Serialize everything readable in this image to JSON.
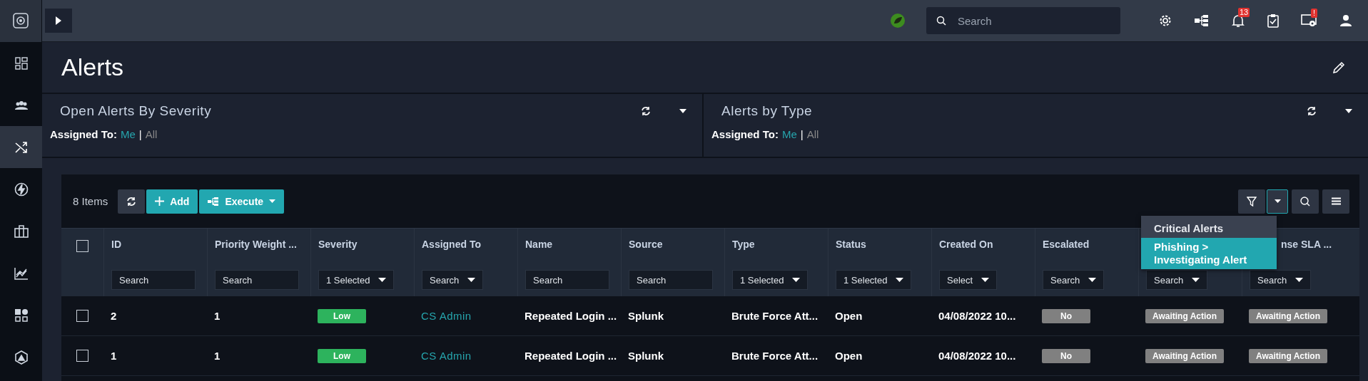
{
  "topbar": {
    "search": {
      "placeholder": "Search"
    },
    "notification_count": "13",
    "alert_badge": "!"
  },
  "sidebar": {
    "items": [
      {
        "selected": false
      },
      {
        "selected": false
      },
      {
        "selected": true
      },
      {
        "selected": false
      },
      {
        "selected": false
      },
      {
        "selected": false
      },
      {
        "selected": false
      },
      {
        "selected": false
      }
    ]
  },
  "page": {
    "title": "Alerts"
  },
  "widgets": [
    {
      "title": "Open Alerts By Severity",
      "assigned_label": "Assigned To:",
      "separator": "|",
      "options": [
        {
          "label": "Me",
          "selected": true
        },
        {
          "label": "All",
          "selected": false
        }
      ]
    },
    {
      "title": "Alerts by Type",
      "assigned_label": "Assigned To:",
      "separator": "|",
      "options": [
        {
          "label": "Me",
          "selected": true
        },
        {
          "label": "All",
          "selected": false
        }
      ]
    }
  ],
  "table": {
    "count": "8 Items",
    "add_label": "Add",
    "execute_label": "Execute",
    "header_checkbox": {
      "checked": false
    },
    "columns": [
      {
        "label": "ID",
        "filter": {
          "kind": "text",
          "placeholder": "Search"
        }
      },
      {
        "label": "Priority Weight ...",
        "filter": {
          "kind": "text",
          "placeholder": "Search"
        }
      },
      {
        "label": "Severity",
        "filter": {
          "kind": "select",
          "value": "1 Selected"
        }
      },
      {
        "label": "Assigned To",
        "filter": {
          "kind": "select",
          "value": "Search"
        }
      },
      {
        "label": "Name",
        "filter": {
          "kind": "text",
          "placeholder": "Search"
        }
      },
      {
        "label": "Source",
        "filter": {
          "kind": "text",
          "placeholder": "Search"
        }
      },
      {
        "label": "Type",
        "filter": {
          "kind": "select",
          "value": "1 Selected"
        }
      },
      {
        "label": "Status",
        "filter": {
          "kind": "select",
          "value": "1 Selected"
        }
      },
      {
        "label": "Created On",
        "filter": {
          "kind": "select",
          "value": "Select"
        }
      },
      {
        "label": "Escalated",
        "filter": {
          "kind": "select",
          "value": "Search"
        }
      },
      {
        "filter": {
          "kind": "select",
          "value": "Search"
        }
      },
      {
        "label": "nse SLA ...",
        "clipped": true,
        "filter": {
          "kind": "select",
          "value": "Search"
        }
      }
    ],
    "rows": [
      {
        "checked": false,
        "cells": [
          {
            "kind": "text",
            "text": "2"
          },
          {
            "kind": "text",
            "text": "1"
          },
          {
            "kind": "badge",
            "text": "Low",
            "color": "#2db35d"
          },
          {
            "kind": "link",
            "text": "CS Admin"
          },
          {
            "kind": "text",
            "text": "Repeated Login ..."
          },
          {
            "kind": "text",
            "text": "Splunk"
          },
          {
            "kind": "text",
            "text": "Brute Force Att..."
          },
          {
            "kind": "text",
            "text": "Open"
          },
          {
            "kind": "text",
            "text": "04/08/2022 10..."
          },
          {
            "kind": "badge",
            "text": "No",
            "color": "#808080"
          },
          {
            "kind": "badge",
            "text": "Awaiting Action",
            "color": "#808080"
          },
          {
            "kind": "badge",
            "text": "Awaiting Action",
            "color": "#808080"
          }
        ]
      },
      {
        "checked": false,
        "cells": [
          {
            "kind": "text",
            "text": "1"
          },
          {
            "kind": "text",
            "text": "1"
          },
          {
            "kind": "badge",
            "text": "Low",
            "color": "#2db35d"
          },
          {
            "kind": "link",
            "text": "CS Admin"
          },
          {
            "kind": "text",
            "text": "Repeated Login ..."
          },
          {
            "kind": "text",
            "text": "Splunk"
          },
          {
            "kind": "text",
            "text": "Brute Force Att..."
          },
          {
            "kind": "text",
            "text": "Open"
          },
          {
            "kind": "text",
            "text": "04/08/2022 10..."
          },
          {
            "kind": "badge",
            "text": "No",
            "color": "#808080"
          },
          {
            "kind": "badge",
            "text": "Awaiting Action",
            "color": "#808080"
          },
          {
            "kind": "badge",
            "text": "Awaiting Action",
            "color": "#808080"
          }
        ]
      }
    ]
  },
  "filter_menu": {
    "items": [
      {
        "label": "Critical Alerts",
        "selected": false
      },
      {
        "label": "Phishing > Investigating Alert",
        "selected": true
      }
    ]
  }
}
